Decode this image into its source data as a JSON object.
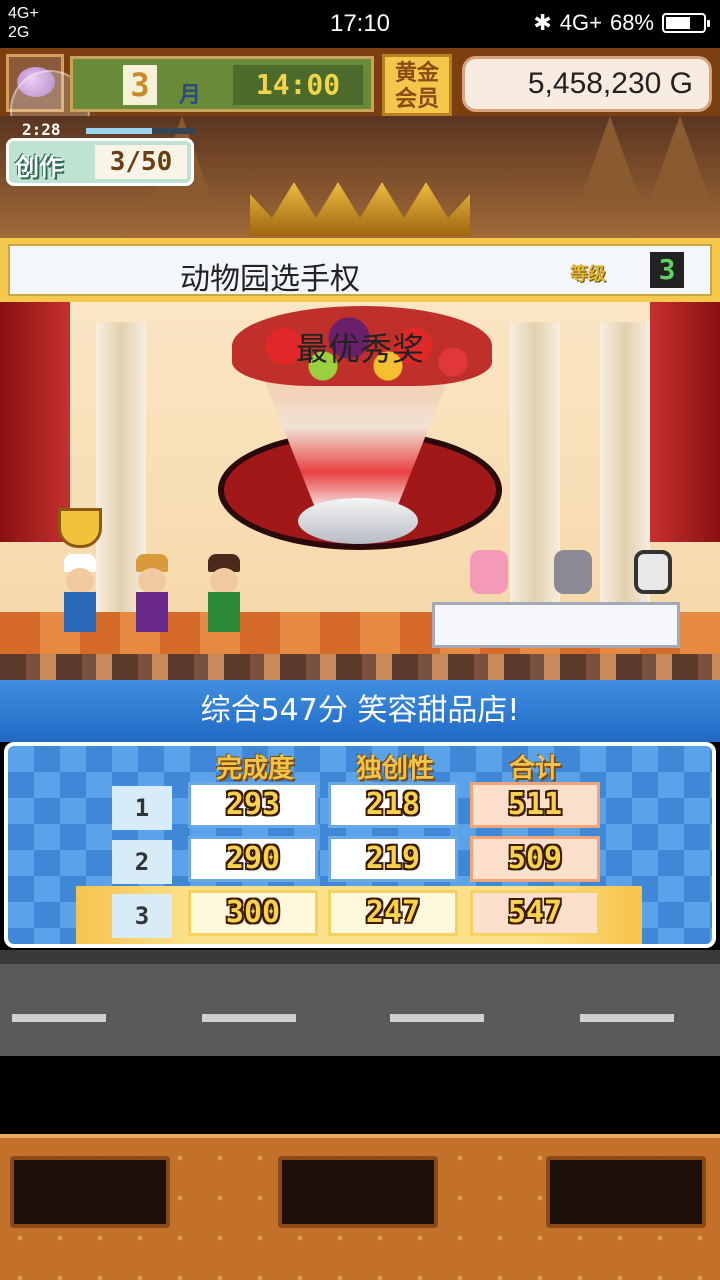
{
  "status_bar": {
    "network_top": "4G+",
    "network_bottom": "2G",
    "time": "17:10",
    "network_right": "4G+",
    "battery": "68%",
    "battery_level": 0.68
  },
  "hud": {
    "month": "3",
    "month_label": "月",
    "clock": "14:00",
    "member_badge": "黄金会员",
    "money": "5,458,230 G",
    "timer": "2:28",
    "create_label": "创作",
    "create_count": "3/50"
  },
  "contest": {
    "title": "动物园选手权",
    "level_label": "等级",
    "level": "3",
    "award": "最优秀奖"
  },
  "result": {
    "summary": "综合547分 笑容甜品店!",
    "headers": [
      "完成度",
      "独创性",
      "合计"
    ],
    "rows": [
      {
        "rank": "1",
        "completion": "293",
        "originality": "218",
        "total": "511"
      },
      {
        "rank": "2",
        "completion": "290",
        "originality": "219",
        "total": "509"
      },
      {
        "rank": "3",
        "completion": "300",
        "originality": "247",
        "total": "547"
      }
    ]
  },
  "colors": {
    "banner_blue": "#2069c4",
    "gold_text": "#f8d24a",
    "highlight_row": "#fbe28a"
  }
}
